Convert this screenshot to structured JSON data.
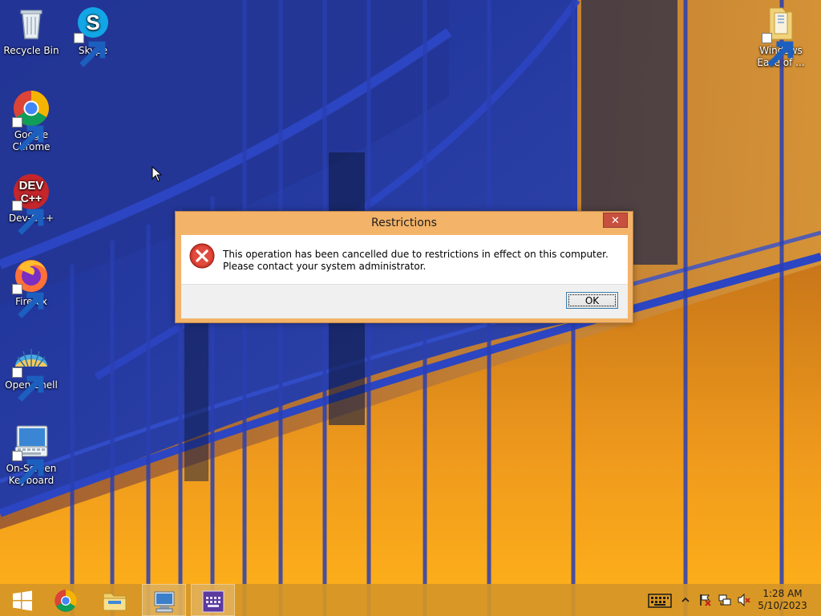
{
  "desktop": {
    "icons": [
      {
        "label": "Recycle Bin",
        "icon": "recycle-bin-icon"
      },
      {
        "label": "Skype",
        "icon": "skype-icon"
      },
      {
        "label": "Google Chrome",
        "icon": "chrome-icon"
      },
      {
        "label": "Dev-C++",
        "icon": "devcpp-icon"
      },
      {
        "label": "Firefox",
        "icon": "firefox-icon"
      },
      {
        "label": "Open-Shell",
        "icon": "open-shell-icon"
      },
      {
        "label": "On-Screen Keyboard",
        "icon": "keyboard-icon"
      },
      {
        "label": "Windows Ease of ...",
        "icon": "folder-icon"
      }
    ]
  },
  "dialog": {
    "title": "Restrictions",
    "close_label": "✕",
    "message": "This operation has been cancelled due to restrictions in effect on this computer. Please contact your system administrator.",
    "ok_label": "OK",
    "icon": "error-icon"
  },
  "taskbar": {
    "items": [
      "start-button",
      "chrome",
      "file-explorer",
      "remote-desktop",
      "on-screen-keyboard"
    ],
    "clock_time": "1:28 AM",
    "clock_date": "5/10/2023"
  },
  "colors": {
    "taskbar": "#d69626",
    "dialog_frame": "#f3b368",
    "close_button": "#c7503f"
  }
}
